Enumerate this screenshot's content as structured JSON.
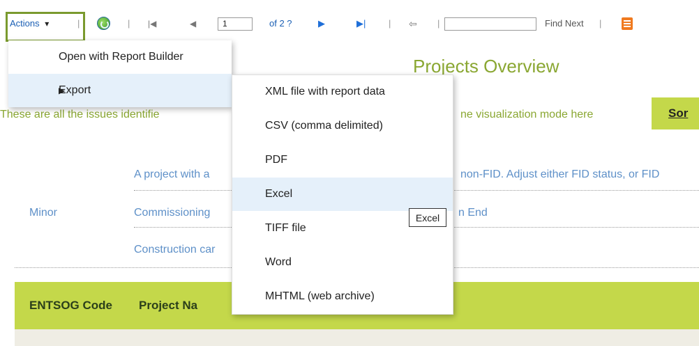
{
  "toolbar": {
    "actions_label": "Actions",
    "actions_caret": "▾",
    "separator": "|",
    "page_current": "1",
    "page_of": "of 2 ?",
    "find_next_label": "Find Next",
    "icons": {
      "refresh": "refresh-icon",
      "first_page": "first-page-icon",
      "prev_page": "previous-page-icon",
      "next_page": "next-page-icon",
      "last_page": "last-page-icon",
      "back": "back-icon",
      "report": "report-icon"
    }
  },
  "report": {
    "title": "Projects Overview",
    "description_left": "These are all the issues identifie",
    "description_right": "ne visualization mode here",
    "sort_label": "Sor",
    "issue_lines": [
      {
        "left": "A project with a",
        "right": "non-FID. Adjust either FID status, or FID"
      },
      {
        "left": "Commissioning",
        "right": "n End"
      },
      {
        "left": "Construction car",
        "right": ""
      }
    ],
    "severity": "Minor",
    "table_headers": [
      "ENTSOG Code",
      "Project Na"
    ]
  },
  "actions_menu": {
    "items": [
      {
        "label": "Open with Report Builder"
      },
      {
        "label": "Export",
        "submenu_caret": "▶"
      }
    ]
  },
  "export_menu": {
    "items": [
      {
        "label": "XML file with report data"
      },
      {
        "label": "CSV (comma delimited)"
      },
      {
        "label": "PDF"
      },
      {
        "label": "Excel"
      },
      {
        "label": "TIFF file"
      },
      {
        "label": "Word"
      },
      {
        "label": "MHTML (web archive)"
      }
    ],
    "hovered": "Excel"
  },
  "tooltip": {
    "text": "Excel"
  },
  "colors": {
    "accent_green": "#8aa732",
    "header_green": "#c4d84a",
    "link_blue": "#5e90c8",
    "highlight_border": "#7a9a2e",
    "menu_hover": "#e5f0fa"
  }
}
